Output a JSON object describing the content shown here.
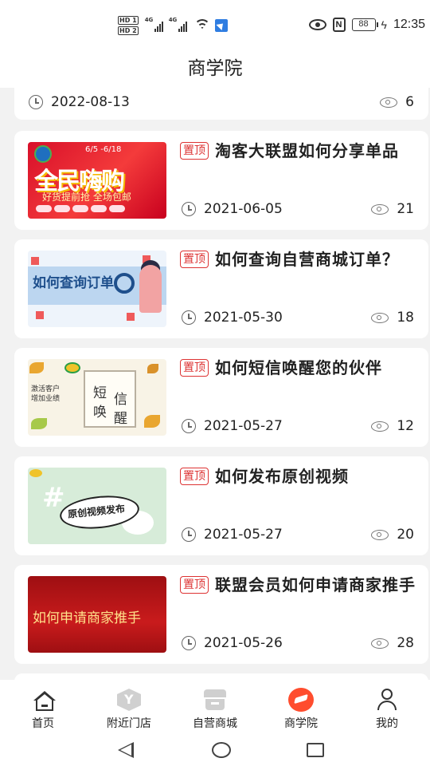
{
  "status_bar": {
    "sim1": "HD 1",
    "sim2": "HD 2",
    "net1": "4G",
    "net2": "4G",
    "nfc": "N",
    "battery": "88",
    "time": "12:35"
  },
  "header": {
    "title": "商学院"
  },
  "partial_item": {
    "date": "2022-08-13",
    "views": "6"
  },
  "articles": [
    {
      "tag": "置顶",
      "title": "淘客大联盟如何分享单品",
      "date": "2021-06-05",
      "views": "21",
      "thumb": {
        "date_range": "6/5 -6/18",
        "headline": "全民嗨购",
        "sub": "好货提前抢 全场包邮"
      }
    },
    {
      "tag": "置顶",
      "title": "如何查询自营商城订单？",
      "date": "2021-05-30",
      "views": "18",
      "thumb": {
        "headline": "如何查询订单"
      }
    },
    {
      "tag": "置顶",
      "title": "如何短信唤醒您的伙伴",
      "date": "2021-05-27",
      "views": "12",
      "thumb": {
        "side": "激活客户 增加业绩",
        "w1": "短",
        "w2": "唤",
        "w3": "信",
        "w4": "醒"
      }
    },
    {
      "tag": "置顶",
      "title": "如何发布原创视频",
      "date": "2021-05-27",
      "views": "20",
      "thumb": {
        "headline": "原创视频发布"
      }
    },
    {
      "tag": "置顶",
      "title": "联盟会员如何申请商家推手",
      "date": "2021-05-26",
      "views": "28",
      "thumb": {
        "headline": "如何申请商家推手"
      }
    }
  ],
  "bottom_nav": [
    {
      "label": "首页",
      "icon": "home-icon"
    },
    {
      "label": "附近门店",
      "icon": "store-icon"
    },
    {
      "label": "自营商城",
      "icon": "mall-icon"
    },
    {
      "label": "商学院",
      "icon": "school-icon",
      "active": true
    },
    {
      "label": "我的",
      "icon": "profile-icon"
    }
  ],
  "colors": {
    "tag": "#dd3333",
    "active_nav": "#ff4d2e",
    "background": "#f2f2f2"
  }
}
